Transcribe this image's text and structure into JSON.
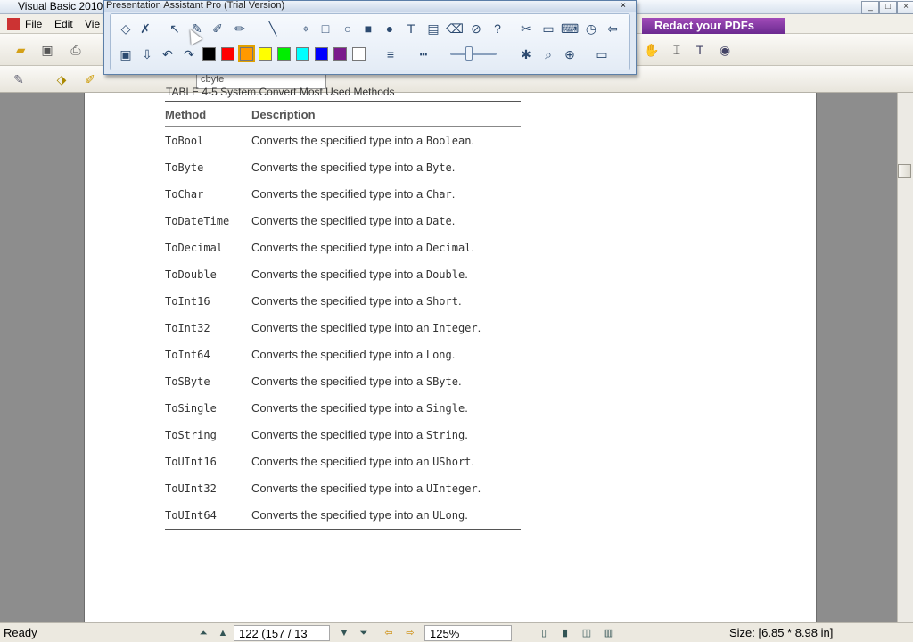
{
  "app": {
    "title": "Visual Basic 2010",
    "window_buttons": [
      "_",
      "□",
      "×"
    ]
  },
  "menu": [
    "File",
    "Edit",
    "Vie"
  ],
  "banner": {
    "label": "Redact your PDFs"
  },
  "toolbar2": {
    "field_value": "cbyte"
  },
  "overlay": {
    "title": "Presentation Assistant Pro (Trial Version)",
    "close": "×",
    "palette": [
      "#000000",
      "#ff0000",
      "#ff9900",
      "#ffff00",
      "#00ee00",
      "#00ffff",
      "#0000ff",
      "#7a1a8c",
      "#ffffff"
    ],
    "selected_swatch": 2
  },
  "document": {
    "caption_fragment": "TABLE 4-5   System.Convert Most Used Methods",
    "columns": {
      "method": "Method",
      "description": "Description"
    },
    "rows": [
      {
        "method": "ToBool",
        "text": "Converts the specified type into a ",
        "type": "Boolean",
        "end": "."
      },
      {
        "method": "ToByte",
        "text": "Converts the specified type into a ",
        "type": "Byte",
        "end": "."
      },
      {
        "method": "ToChar",
        "text": "Converts the specified type into a ",
        "type": "Char",
        "end": "."
      },
      {
        "method": "ToDateTime",
        "text": "Converts the specified type into a ",
        "type": "Date",
        "end": "."
      },
      {
        "method": "ToDecimal",
        "text": "Converts the specified type into a ",
        "type": "Decimal",
        "end": "."
      },
      {
        "method": "ToDouble",
        "text": "Converts the specified type into a ",
        "type": "Double",
        "end": "."
      },
      {
        "method": "ToInt16",
        "text": "Converts the specified type into a ",
        "type": "Short",
        "end": "."
      },
      {
        "method": "ToInt32",
        "text": "Converts the specified type into an ",
        "type": "Integer",
        "end": "."
      },
      {
        "method": "ToInt64",
        "text": "Converts the specified type into a ",
        "type": "Long",
        "end": "."
      },
      {
        "method": "ToSByte",
        "text": "Converts the specified type into a ",
        "type": "SByte",
        "end": "."
      },
      {
        "method": "ToSingle",
        "text": "Converts the specified type into a ",
        "type": "Single",
        "end": "."
      },
      {
        "method": "ToString",
        "text": "Converts the specified type into a ",
        "type": "String",
        "end": "."
      },
      {
        "method": "ToUInt16",
        "text": "Converts the specified type into an ",
        "type": "UShort",
        "end": "."
      },
      {
        "method": "ToUInt32",
        "text": "Converts the specified type into a ",
        "type": "UInteger",
        "end": "."
      },
      {
        "method": "ToUInt64",
        "text": "Converts the specified type into an ",
        "type": "ULong",
        "end": "."
      }
    ]
  },
  "status": {
    "ready": "Ready",
    "page": "122  (157 / 13",
    "zoom": "125%",
    "size": "Size: [6.85 * 8.98 in]"
  }
}
